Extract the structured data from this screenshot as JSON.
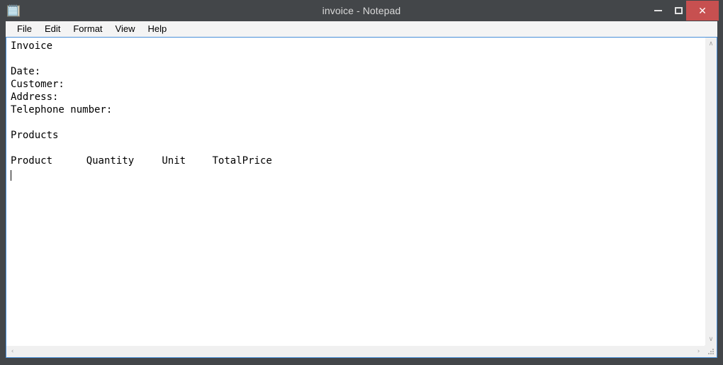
{
  "window": {
    "title": "invoice - Notepad",
    "app_icon": "notepad-icon",
    "controls": {
      "minimize_label": "–",
      "maximize_label": "❐",
      "close_label": "✕"
    },
    "colors": {
      "frame": "#434649",
      "titlebar": "#434649",
      "title_text": "#d9d9d9",
      "close_button": "#c75050",
      "accent_border": "#4a90d9",
      "menu_bar": "#f4f4f4",
      "editor_background": "#ffffff",
      "scrollbar_track": "#f0f0f0",
      "scrollbar_arrow": "#a0a0a0"
    }
  },
  "menubar": {
    "items": [
      {
        "label": "File"
      },
      {
        "label": "Edit"
      },
      {
        "label": "Format"
      },
      {
        "label": "View"
      },
      {
        "label": "Help"
      }
    ]
  },
  "editor": {
    "document_name": "invoice",
    "text": "Invoice\n\nDate:\nCustomer:\nAddress:\nTelephone number:\n\nProducts\n\nProduct\t\tQuantity\t\tUnit\tTotalPrice\n",
    "lines": [
      "Invoice",
      "",
      "Date:",
      "Customer:",
      "Address:",
      "Telephone number:",
      "",
      "Products",
      "",
      "Product\t\tQuantity\t\tUnit\tTotalPrice",
      ""
    ],
    "table_headers": [
      "Product",
      "Quantity",
      "Unit",
      "TotalPrice"
    ],
    "caret_line": 11,
    "caret_column": 1,
    "word_wrap": false
  },
  "scrollbars": {
    "vertical": {
      "up_arrow": "∧",
      "down_arrow": "∨"
    },
    "horizontal": {
      "left_arrow": "‹",
      "right_arrow": "›"
    },
    "resize_grip": "resize-grip-icon"
  }
}
